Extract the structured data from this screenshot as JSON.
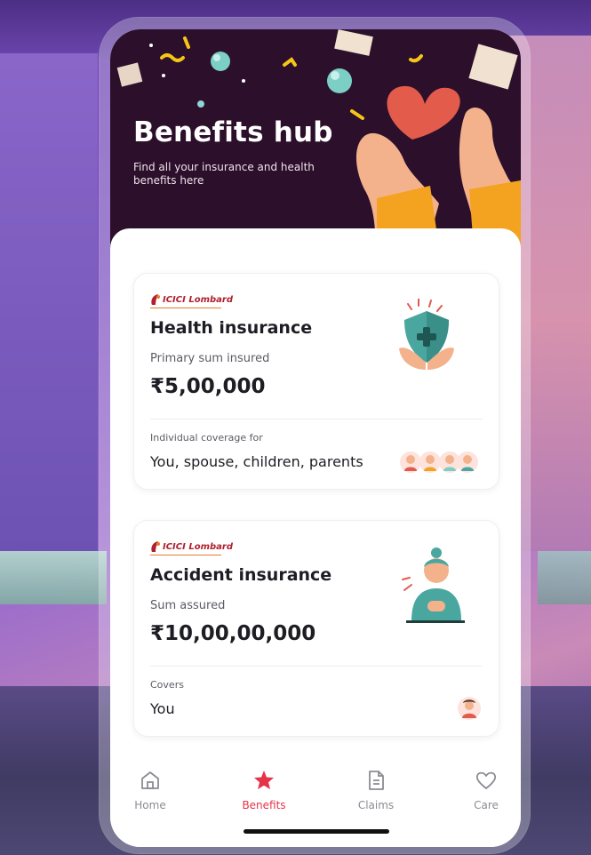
{
  "hero": {
    "title": "Benefits hub",
    "subtitle": "Find all your insurance and health benefits here"
  },
  "cards": [
    {
      "insurer": "ICICI Lombard",
      "title": "Health insurance",
      "amount_label": "Primary sum insured",
      "amount": "₹5,00,000",
      "coverage_label": "Individual coverage for",
      "coverage_value": "You, spouse, children, parents"
    },
    {
      "insurer": "ICICI Lombard",
      "title": "Accident insurance",
      "amount_label": "Sum assured",
      "amount": "₹10,00,00,000",
      "coverage_label": "Covers",
      "coverage_value": "You"
    }
  ],
  "tabs": [
    {
      "label": "Home",
      "icon": "home-icon",
      "active": false
    },
    {
      "label": "Benefits",
      "icon": "star-icon",
      "active": true
    },
    {
      "label": "Claims",
      "icon": "document-icon",
      "active": false
    },
    {
      "label": "Care",
      "icon": "heart-icon",
      "active": false
    }
  ],
  "colors": {
    "hero_bg": "#2c0f2a",
    "accent": "#e5334a",
    "text_primary": "#1f1d24"
  }
}
